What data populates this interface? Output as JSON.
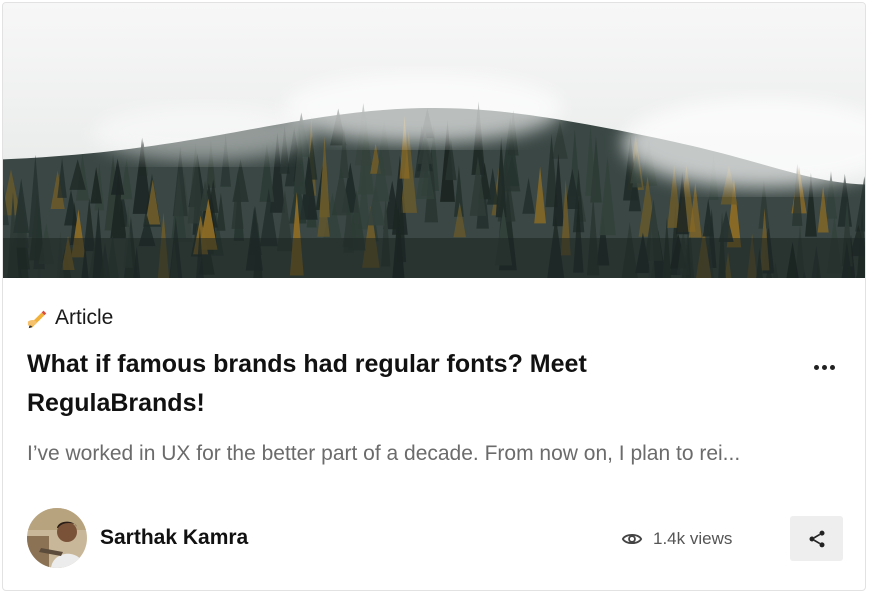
{
  "post": {
    "type_label": "Article",
    "type_icon": "writing-hand-icon",
    "title": "What if famous brands had regular fonts? Meet RegulaBrands!",
    "excerpt": "I’ve worked in UX for the better part of a decade. From now on, I plan to rei...",
    "author": {
      "name": "Sarthak Kamra"
    },
    "stats": {
      "views": "1.4k views"
    },
    "actions": {
      "more_icon": "more-horizontal-icon",
      "share_icon": "share-icon",
      "views_icon": "eye-icon"
    }
  },
  "colors": {
    "title": "#111111",
    "excerpt": "#6b6b6b",
    "card_border": "#e2e2e2",
    "share_bg": "#eeeeee"
  }
}
